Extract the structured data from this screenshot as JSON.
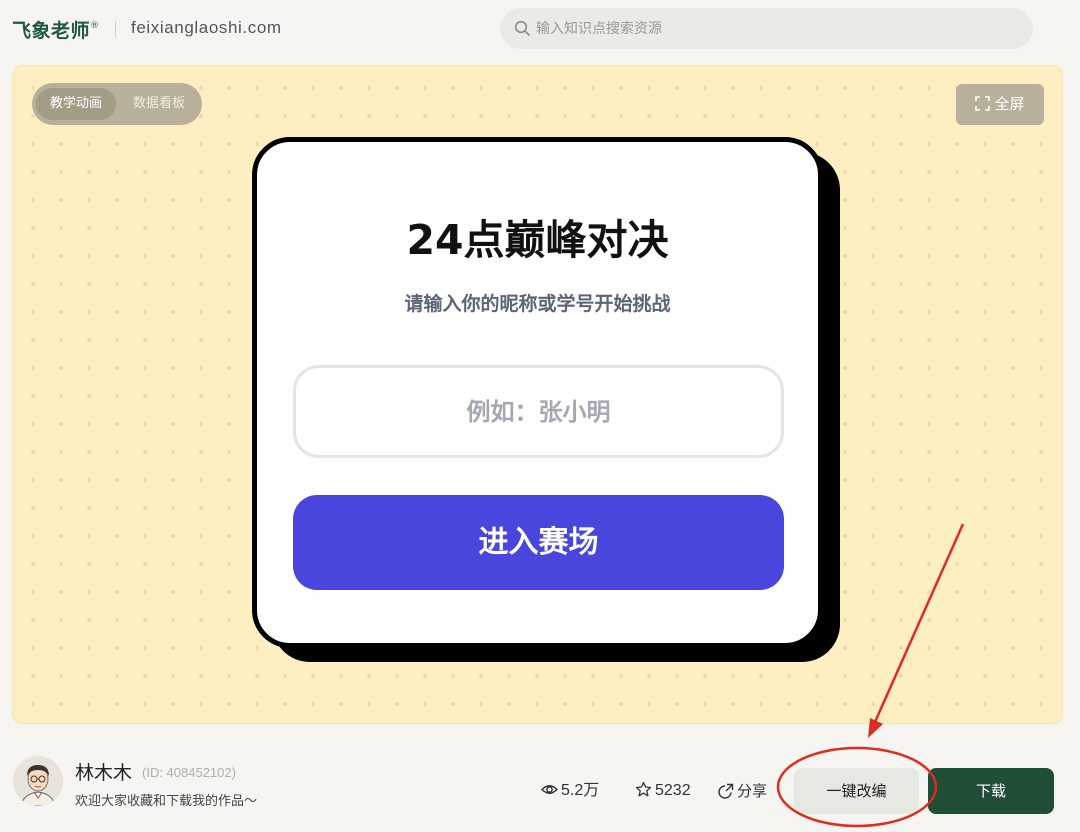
{
  "header": {
    "logo": "飞象老师",
    "logo_mark": "®",
    "domain": "feixianglaoshi.com",
    "search_placeholder": "输入知识点搜索资源"
  },
  "stage": {
    "tabs": [
      {
        "label": "教学动画",
        "active": true
      },
      {
        "label": "数据看板",
        "active": false
      }
    ],
    "fullscreen_label": "全屏",
    "background_color": "#fdefc2"
  },
  "game": {
    "title": "24点巅峰对决",
    "subtitle": "请输入你的昵称或学号开始挑战",
    "input_placeholder": "例如：张小明",
    "input_value": "",
    "enter_button": "进入赛场",
    "accent_color": "#4a45dd"
  },
  "footer": {
    "author_name": "林木木",
    "author_id": "(ID: 408452102)",
    "author_desc": "欢迎大家收藏和下载我的作品～",
    "views": "5.2万",
    "stars": "5232",
    "share_label": "分享",
    "remix_button": "一键改编",
    "download_button": "下载",
    "primary_color": "#1f4d36"
  },
  "annotation": {
    "color": "#e02b20",
    "highlight": "remix-button"
  }
}
